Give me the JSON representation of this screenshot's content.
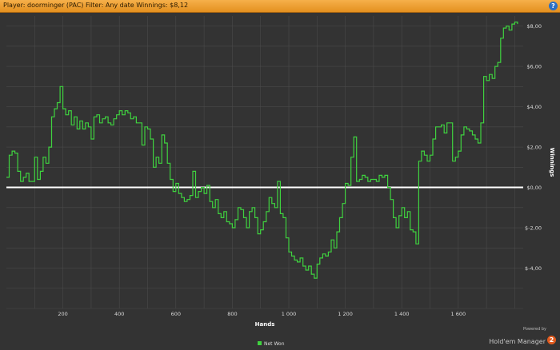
{
  "header": {
    "title": "Player: doorminger (PAC) Filter: Any date  Winnings: $8,12",
    "help_label": "?"
  },
  "branding": {
    "powered_by": "Powered by",
    "product": "Hold'em Manager",
    "badge": "2"
  },
  "colors": {
    "background": "#333333",
    "grid": "#4a4a4a",
    "series": "#3fd23f",
    "zero_line": "#ffffff",
    "title_bar": "#f0a030"
  },
  "chart_data": {
    "type": "line",
    "xlabel": "Hands",
    "ylabel": "Winnings",
    "xlim": [
      0,
      1830
    ],
    "ylim": [
      -6,
      8.5
    ],
    "x_ticks": [
      200,
      400,
      600,
      800,
      1000,
      1200,
      1400,
      1600
    ],
    "x_tick_labels": [
      "200",
      "400",
      "600",
      "800",
      "1 000",
      "1 200",
      "1 400",
      "1 600"
    ],
    "y_ticks": [
      -4,
      -2,
      0,
      2,
      4,
      6,
      8
    ],
    "y_tick_labels": [
      "$-4,00",
      "$-2,00",
      "$0,00",
      "$2,00",
      "$4,00",
      "$6,00",
      "$8,00"
    ],
    "grid": true,
    "legend_position": "bottom",
    "series": [
      {
        "name": "Net Won",
        "x": [
          0,
          10,
          20,
          30,
          40,
          50,
          60,
          70,
          80,
          90,
          100,
          110,
          120,
          130,
          140,
          150,
          160,
          170,
          180,
          190,
          200,
          210,
          220,
          230,
          240,
          250,
          260,
          270,
          280,
          290,
          300,
          310,
          320,
          330,
          340,
          350,
          360,
          370,
          380,
          390,
          400,
          410,
          420,
          430,
          440,
          450,
          460,
          470,
          480,
          490,
          500,
          510,
          520,
          530,
          540,
          550,
          560,
          570,
          580,
          590,
          600,
          610,
          620,
          630,
          640,
          650,
          660,
          670,
          680,
          690,
          700,
          710,
          720,
          730,
          740,
          750,
          760,
          770,
          780,
          790,
          800,
          810,
          820,
          830,
          840,
          850,
          860,
          870,
          880,
          890,
          900,
          910,
          920,
          930,
          940,
          950,
          960,
          970,
          980,
          990,
          1000,
          1010,
          1020,
          1030,
          1040,
          1050,
          1060,
          1070,
          1080,
          1090,
          1100,
          1110,
          1120,
          1130,
          1140,
          1150,
          1160,
          1170,
          1180,
          1190,
          1200,
          1210,
          1220,
          1230,
          1240,
          1250,
          1260,
          1270,
          1280,
          1290,
          1300,
          1310,
          1320,
          1330,
          1340,
          1350,
          1360,
          1370,
          1380,
          1390,
          1400,
          1410,
          1420,
          1430,
          1440,
          1450,
          1460,
          1470,
          1480,
          1490,
          1500,
          1510,
          1520,
          1530,
          1540,
          1550,
          1560,
          1570,
          1580,
          1590,
          1600,
          1610,
          1620,
          1630,
          1640,
          1650,
          1660,
          1670,
          1680,
          1690,
          1700,
          1710,
          1720,
          1730,
          1740,
          1750,
          1760,
          1770,
          1780,
          1790,
          1800,
          1810
        ],
        "y": [
          0.5,
          1.6,
          1.8,
          1.7,
          0.8,
          0.3,
          0.5,
          0.7,
          0.3,
          0.3,
          1.5,
          0.4,
          0.8,
          1.5,
          1.2,
          2.0,
          3.5,
          3.9,
          4.2,
          5.0,
          3.9,
          3.6,
          3.8,
          3.1,
          3.5,
          2.9,
          3.3,
          2.9,
          3.2,
          3.0,
          2.4,
          3.5,
          3.6,
          3.2,
          3.4,
          3.5,
          3.2,
          3.1,
          3.4,
          3.6,
          3.8,
          3.6,
          3.8,
          3.7,
          3.4,
          3.5,
          3.2,
          3.2,
          2.1,
          3.0,
          2.9,
          2.4,
          1.0,
          1.5,
          1.2,
          2.6,
          2.2,
          1.2,
          0.4,
          -0.2,
          0.2,
          -0.3,
          -0.5,
          -0.7,
          -0.6,
          -0.4,
          0.8,
          -0.5,
          -0.2,
          0.0,
          -0.3,
          0.1,
          -0.7,
          -1.0,
          -0.6,
          -1.3,
          -1.5,
          -1.2,
          -1.7,
          -1.8,
          -2.0,
          -1.6,
          -1.0,
          -1.1,
          -1.5,
          -2.0,
          -1.2,
          -1.0,
          -1.5,
          -2.3,
          -2.1,
          -1.7,
          -1.2,
          -0.5,
          -0.8,
          -1.0,
          0.3,
          -1.3,
          -1.5,
          -2.5,
          -3.2,
          -3.4,
          -3.6,
          -3.7,
          -3.5,
          -3.9,
          -4.1,
          -3.9,
          -4.3,
          -4.5,
          -3.8,
          -3.5,
          -3.3,
          -3.4,
          -3.2,
          -2.6,
          -3.0,
          -2.2,
          -1.5,
          -0.8,
          0.2,
          0.1,
          1.5,
          2.5,
          0.3,
          0.4,
          0.6,
          0.5,
          0.3,
          0.4,
          0.4,
          0.3,
          0.6,
          0.5,
          0.6,
          0.0,
          -0.6,
          -1.5,
          -2.0,
          -1.4,
          -1.0,
          -1.5,
          -1.2,
          -2.1,
          -2.2,
          -2.8,
          1.3,
          1.8,
          1.6,
          1.3,
          1.6,
          2.4,
          3.0,
          3.0,
          3.1,
          2.7,
          3.2,
          3.2,
          1.3,
          1.5,
          1.8,
          2.6,
          3.0,
          2.9,
          2.8,
          2.6,
          2.4,
          2.2,
          3.2,
          5.5,
          5.3,
          5.6,
          5.4,
          6.0,
          6.2,
          7.4,
          7.9,
          8.0,
          7.8,
          8.1,
          8.2,
          8.1
        ]
      }
    ]
  }
}
